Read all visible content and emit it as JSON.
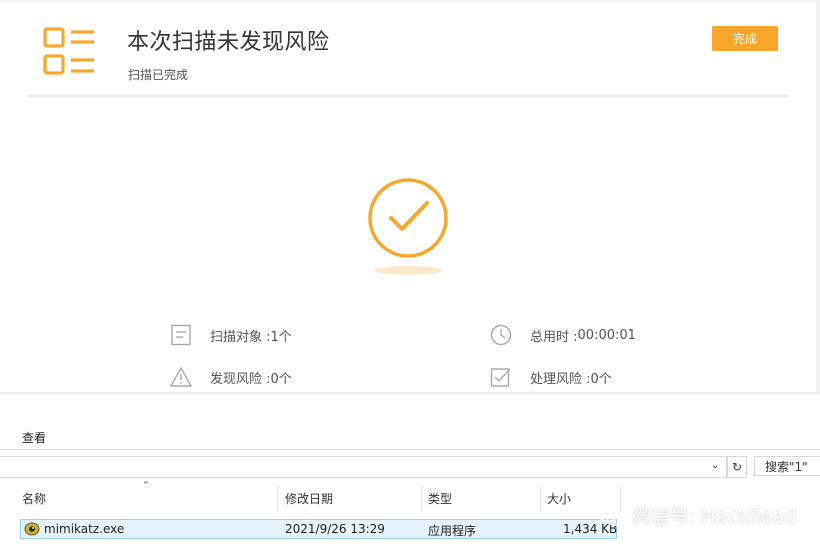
{
  "scan": {
    "title": "本次扫描未发现风险",
    "subtitle": "扫描已完成",
    "done_label": "完成",
    "accent_color": "#f9a72b",
    "icons": {
      "report": "report-list-icon",
      "status": "check-circle-icon"
    },
    "stats": [
      {
        "label": "扫描对象",
        "value": "1个",
        "icon": "document-icon"
      },
      {
        "label": "总用时",
        "value": "00:00:01",
        "icon": "clock-icon"
      },
      {
        "label": "发现风险",
        "value": "0个",
        "icon": "warning-icon"
      },
      {
        "label": "处理风险",
        "value": "0个",
        "icon": "checkbox-icon"
      }
    ]
  },
  "explorer": {
    "menu": {
      "view_label": "查看"
    },
    "search": {
      "placeholder": "搜索\"1\""
    },
    "columns": {
      "name": "名称",
      "modified": "修改日期",
      "type": "类型",
      "size": "大小"
    },
    "files": [
      {
        "name": "mimikatz.exe",
        "modified": "2021/9/26 13:29",
        "type": "应用程序",
        "size": "1,434 KB",
        "icon": "application-icon"
      }
    ]
  },
  "watermark": {
    "text": "微信号: HackRead",
    "icon": "wechat-icon"
  }
}
